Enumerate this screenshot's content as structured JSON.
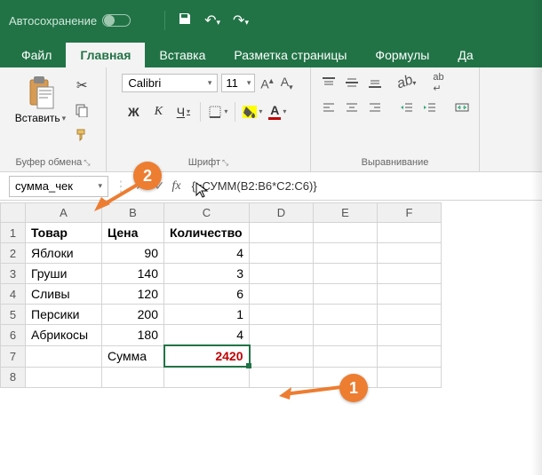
{
  "titlebar": {
    "autosave_label": "Автосохранение"
  },
  "tabs": [
    "Файл",
    "Главная",
    "Вставка",
    "Разметка страницы",
    "Формулы",
    "Да"
  ],
  "active_tab_index": 1,
  "ribbon": {
    "clipboard": {
      "paste": "Вставить",
      "group": "Буфер обмена"
    },
    "font": {
      "name": "Calibri",
      "size": "11",
      "bold": "Ж",
      "italic": "К",
      "underline": "Ч",
      "letterA": "A",
      "group": "Шрифт"
    },
    "alignment": {
      "group": "Выравнивание"
    }
  },
  "namebox": "сумма_чек",
  "formula": "{=СУММ(B2:B6*C2:C6)}",
  "columns": [
    "A",
    "B",
    "C",
    "D",
    "E",
    "F"
  ],
  "rows": [
    {
      "n": "1",
      "A": "Товар",
      "B": "Цена",
      "C": "Количество",
      "bold": true
    },
    {
      "n": "2",
      "A": "Яблоки",
      "B": "90",
      "C": "4"
    },
    {
      "n": "3",
      "A": "Груши",
      "B": "140",
      "C": "3"
    },
    {
      "n": "4",
      "A": "Сливы",
      "B": "120",
      "C": "6"
    },
    {
      "n": "5",
      "A": "Персики",
      "B": "200",
      "C": "1"
    },
    {
      "n": "6",
      "A": "Абрикосы",
      "B": "180",
      "C": "4"
    },
    {
      "n": "7",
      "A": "",
      "B": "Сумма",
      "C": "2420",
      "sel": true
    },
    {
      "n": "8",
      "A": "",
      "B": "",
      "C": ""
    }
  ],
  "markers": {
    "m1": "1",
    "m2": "2"
  }
}
